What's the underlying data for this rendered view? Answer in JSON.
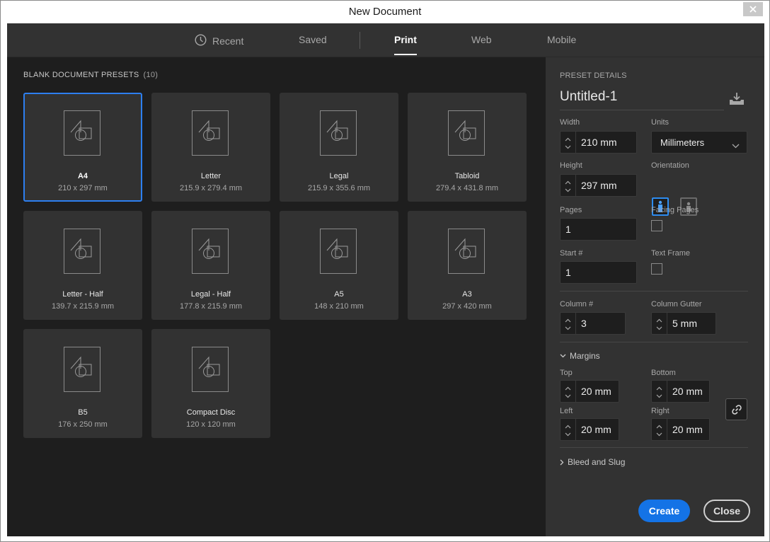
{
  "window": {
    "title": "New Document",
    "close_icon": "close-x-icon"
  },
  "tabs": [
    {
      "label": "Recent",
      "icon": "clock-icon",
      "active": false
    },
    {
      "label": "Saved",
      "active": false
    },
    {
      "label": "Print",
      "active": true
    },
    {
      "label": "Web",
      "active": false
    },
    {
      "label": "Mobile",
      "active": false
    }
  ],
  "presets": {
    "title": "BLANK DOCUMENT PRESETS",
    "count": "(10)",
    "items": [
      {
        "name": "A4",
        "size": "210 x 297 mm",
        "selected": true
      },
      {
        "name": "Letter",
        "size": "215.9 x 279.4 mm"
      },
      {
        "name": "Legal",
        "size": "215.9 x 355.6 mm"
      },
      {
        "name": "Tabloid",
        "size": "279.4 x 431.8 mm"
      },
      {
        "name": "Letter - Half",
        "size": "139.7 x 215.9 mm"
      },
      {
        "name": "Legal - Half",
        "size": "177.8 x 215.9 mm"
      },
      {
        "name": "A5",
        "size": "148 x 210 mm"
      },
      {
        "name": "A3",
        "size": "297 x 420 mm"
      },
      {
        "name": "B5",
        "size": "176 x 250 mm"
      },
      {
        "name": "Compact Disc",
        "size": "120 x 120 mm"
      }
    ]
  },
  "details": {
    "section_title": "PRESET DETAILS",
    "doc_name": "Untitled-1",
    "width_label": "Width",
    "width_value": "210 mm",
    "units_label": "Units",
    "units_value": "Millimeters",
    "height_label": "Height",
    "height_value": "297 mm",
    "orientation_label": "Orientation",
    "orientation": "portrait",
    "pages_label": "Pages",
    "pages_value": "1",
    "facing_label": "Facing Pages",
    "facing_checked": false,
    "start_label": "Start #",
    "start_value": "1",
    "textframe_label": "Text Frame",
    "textframe_checked": false,
    "column_label": "Column #",
    "column_value": "3",
    "gutter_label": "Column Gutter",
    "gutter_value": "5 mm",
    "margins_label": "Margins",
    "top_label": "Top",
    "top_value": "20 mm",
    "bottom_label": "Bottom",
    "bottom_value": "20 mm",
    "left_label": "Left",
    "left_value": "20 mm",
    "right_label": "Right",
    "right_value": "20 mm",
    "bleed_label": "Bleed and Slug"
  },
  "actions": {
    "create_label": "Create",
    "close_label": "Close"
  },
  "colors": {
    "accent": "#1473e6",
    "selected_border": "#2d7ff0",
    "panel_bg": "#323232",
    "canvas_bg": "#1e1e1e"
  }
}
